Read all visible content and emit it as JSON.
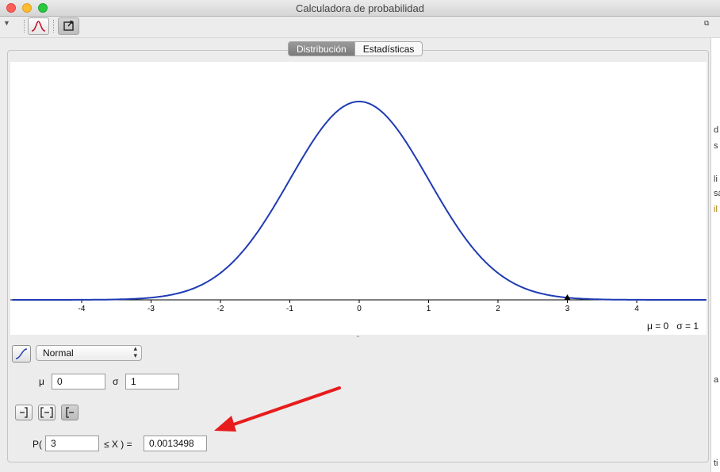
{
  "window": {
    "title": "Calculadora de probabilidad"
  },
  "tabs": [
    {
      "label": "Distribución"
    },
    {
      "label": "Estadísticas"
    }
  ],
  "plot": {
    "params_text": "μ = 0   σ = 1",
    "ticks": [
      "-4",
      "-3",
      "-2",
      "-1",
      "0",
      "1",
      "2",
      "3",
      "4"
    ],
    "marker_x": 3
  },
  "chart_data": {
    "type": "line",
    "series": [
      {
        "function": "normal_pdf",
        "mean": 0,
        "sd": 1
      }
    ],
    "xlim": [
      -5,
      5
    ],
    "xticks": [
      -4,
      -3,
      -2,
      -1,
      0,
      1,
      2,
      3,
      4
    ],
    "colors": {
      "curve": "#1f3bb3"
    }
  },
  "controls": {
    "distribution": "Normal",
    "mu_label": "μ",
    "mu_value": "0",
    "sigma_label": "σ",
    "sigma_value": "1",
    "prob_prefix": "P(",
    "lower_value": "3",
    "prob_middle": "≤ X ) =",
    "result_value": "0.0013498"
  },
  "sidebar": {
    "fragments": [
      "d",
      "s",
      "li",
      "sa",
      "il",
      "a",
      "ti"
    ]
  }
}
